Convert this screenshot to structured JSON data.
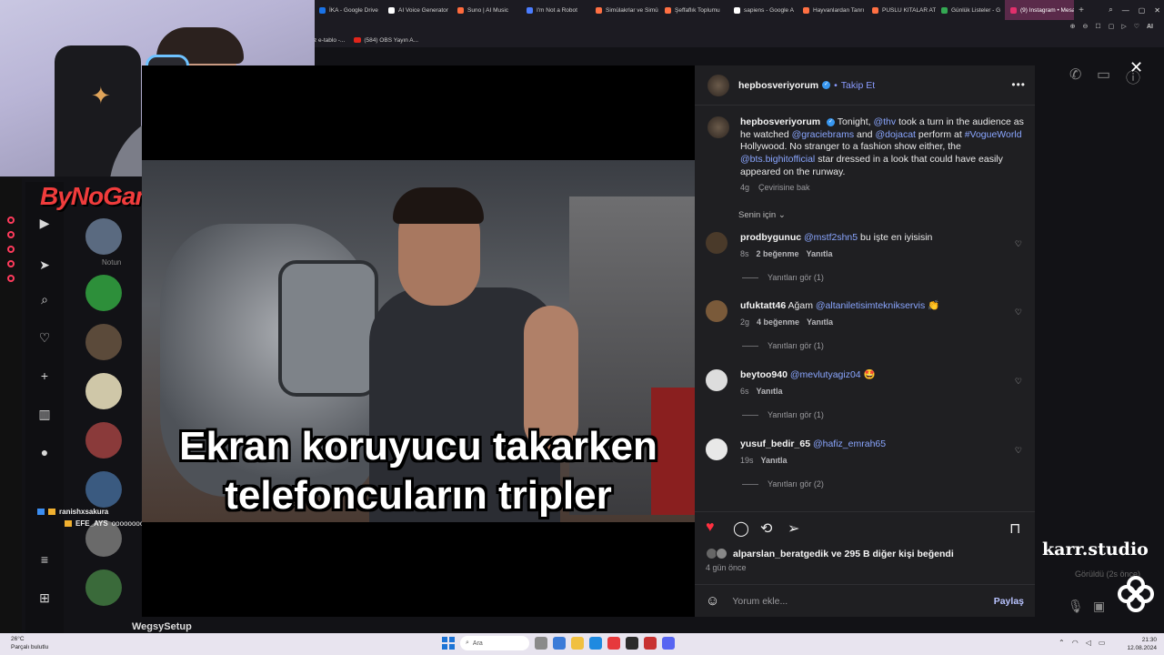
{
  "browser": {
    "tabs": [
      {
        "label": "İKA - Google Drive",
        "color": "#1a73e8"
      },
      {
        "label": "AI Voice Generator",
        "color": "#ffffff"
      },
      {
        "label": "Suno | AI Music",
        "color": "#ff6b3d"
      },
      {
        "label": "I'm Not a Robot",
        "color": "#4a7cff"
      },
      {
        "label": "Simülakrlar ve Simü",
        "color": "#ff7043"
      },
      {
        "label": "Şeffaflık Toplumu",
        "color": "#ff7043"
      },
      {
        "label": "sapiens - Google A",
        "color": "#ffffff"
      },
      {
        "label": "Hayvanlardan Tanrı",
        "color": "#ff7043"
      },
      {
        "label": "PUSLU KITALAR AT",
        "color": "#ff7043"
      },
      {
        "label": "Günlük Listeler - G",
        "color": "#34a853"
      },
      {
        "label": "(9) Instagram • Mesajlar",
        "color": "#e1306c",
        "active": true
      }
    ],
    "bookmarks": [
      {
        "label": "z e-tablo -..."
      },
      {
        "label": "(584) OBS Yayın A..."
      }
    ],
    "address_icons": [
      "⊕",
      "⊖",
      "☐",
      "▢",
      "▷",
      "♡"
    ],
    "ai_label": "AI"
  },
  "stream": {
    "brand": "ByNoGame",
    "chat": [
      {
        "user": "ranishxsakura",
        "text": ""
      },
      {
        "user": "EFE_AYS",
        "text": "oooooooo hoca geldi"
      }
    ],
    "side_dm_name": "Notun",
    "dm_bottom_name": "WegsySetup"
  },
  "video": {
    "caption_line1": "Ekran koruyucu takarken",
    "caption_line2": "telefoncuların tripler"
  },
  "post": {
    "username": "hepbosveriyorum",
    "follow_label": "Takip Et",
    "caption_pre": "Tonight,",
    "caption_m1": "@thv",
    "caption_t1": "took a turn in the audience as he watched",
    "caption_m2": "@graciebrams",
    "caption_t2": "and",
    "caption_m3": "@dojacat",
    "caption_t3": "perform at",
    "caption_m4": "#VogueWorld",
    "caption_t4": "Hollywood. No stranger to a fashion show either, the",
    "caption_m5": "@bts.bighitofficial",
    "caption_t5": "star dressed in a look that could have easily appeared on the runway.",
    "caption_time": "4g",
    "translate": "Çevirisine bak",
    "sort_label": "Senin için",
    "comments": [
      {
        "user": "prodbygunuc",
        "mention": "@mstf2shn5",
        "text": "bu işte en iyisisin",
        "time": "8s",
        "likes": "2 beğenme",
        "reply": "Yanıtla",
        "replies": "Yanıtları gör (1)"
      },
      {
        "user": "ufuktatt46",
        "mention": "@altaniletisimteknikservis",
        "text": "👏",
        "prefix": "Ağam",
        "time": "2g",
        "likes": "4 beğenme",
        "reply": "Yanıtla",
        "replies": "Yanıtları gör (1)"
      },
      {
        "user": "beytoo940",
        "mention": "@mevlutyagiz04",
        "text": "🤩",
        "time": "6s",
        "likes": "",
        "reply": "Yanıtla",
        "replies": "Yanıtları gör (1)"
      },
      {
        "user": "yusuf_bedir_65",
        "mention": "@hafiz_emrah65",
        "text": "",
        "time": "19s",
        "likes": "",
        "reply": "Yanıtla",
        "replies": "Yanıtları gör (2)"
      }
    ],
    "likes_text": "alparslan_beratgedik ve 295 B diğer kişi beğendi",
    "date": "4 gün önce",
    "comment_placeholder": "Yorum ekle...",
    "share_label": "Paylaş"
  },
  "overlay": {
    "karr": "karr.studio",
    "seen": "Görüldü (2s önce)"
  },
  "taskbar": {
    "temp": "26°C",
    "weather": "Parçalı bulutlu",
    "search": "Ara",
    "time": "21:30",
    "date": "12.08.2024"
  }
}
